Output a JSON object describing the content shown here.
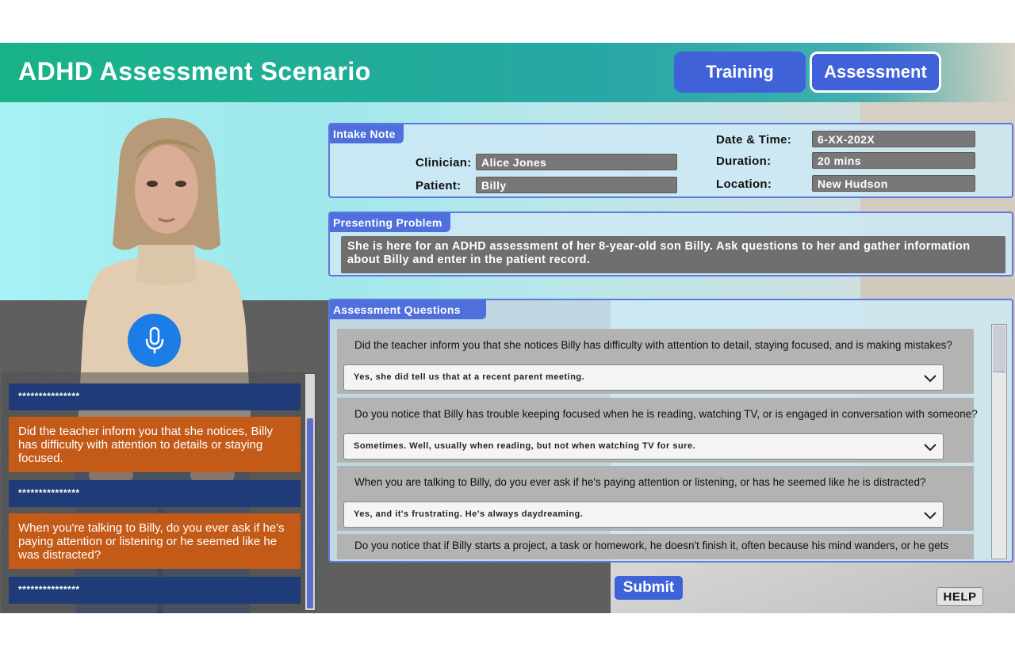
{
  "header": {
    "title": "ADHD Assessment Scenario",
    "tabs": [
      {
        "label": "Training",
        "active": false
      },
      {
        "label": "Assessment",
        "active": true
      }
    ]
  },
  "intake": {
    "tag": "Intake Note",
    "clinician_label": "Clinician:",
    "clinician": "Alice Jones",
    "patient_label": "Patient:",
    "patient": "Billy",
    "datetime_label": "Date & Time:",
    "datetime": "6-XX-202X",
    "duration_label": "Duration:",
    "duration": "20 mins",
    "location_label": "Location:",
    "location": "New Hudson"
  },
  "problem": {
    "tag": "Presenting Problem",
    "text": "She is here for an ADHD assessment of her 8-year-old son Billy. Ask questions to her and gather information about Billy and enter in the patient record."
  },
  "questions": {
    "tag": "Assessment Questions",
    "items": [
      {
        "question": "Did the teacher inform you that she notices Billy has difficulty with attention to detail, staying focused, and is making mistakes?",
        "answer": "Yes, she did tell us that at a recent parent meeting."
      },
      {
        "question": "Do you notice that Billy has trouble keeping focused when he is reading, watching TV, or is engaged in conversation with someone?",
        "answer": "Sometimes. Well, usually when reading, but not when watching TV for sure."
      },
      {
        "question": "When you are talking to Billy, do you ever ask if he's paying attention or listening, or has he seemed like he is distracted?",
        "answer": "Yes, and it's frustrating. He's always daydreaming."
      },
      {
        "question": "Do you notice that if Billy starts a project, a task or homework, he doesn't finish it, often because his mind wanders, or he gets",
        "answer": ""
      }
    ]
  },
  "chat": {
    "items": [
      {
        "kind": "hidden",
        "text": "***************"
      },
      {
        "kind": "message",
        "text": "Did the teacher inform you that she notices, Billy has difficulty with attention to details or staying focused."
      },
      {
        "kind": "hidden",
        "text": "***************"
      },
      {
        "kind": "message",
        "text": "When you're talking to Billy, do you ever ask if he's paying attention or listening or he seemed like he was distracted?"
      },
      {
        "kind": "hidden",
        "text": "***************"
      }
    ]
  },
  "icons": {
    "mic": "microphone-icon",
    "chevron": "chevron-down-icon"
  },
  "buttons": {
    "submit": "Submit",
    "help": "HELP"
  },
  "colors": {
    "accent": "#3f62d8",
    "header": "#17b387",
    "chat_message": "#c45a18",
    "chat_hidden": "#203c78",
    "mic": "#1d7de6"
  }
}
